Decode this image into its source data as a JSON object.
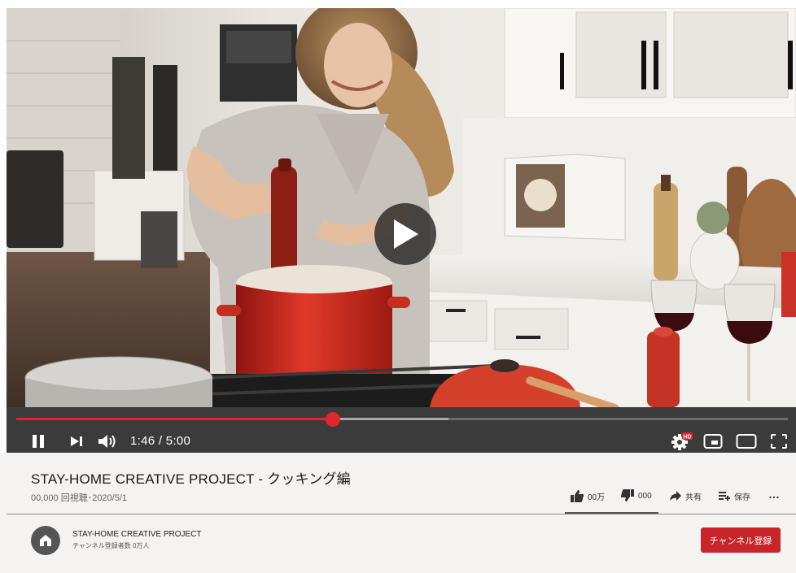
{
  "video": {
    "time_display": "1:46 / 5:00",
    "progress_fraction": 0.41,
    "buffered_fraction": 0.56,
    "hd_badge": "HD"
  },
  "meta": {
    "title": "STAY-HOME CREATIVE PROJECT - クッキング編",
    "views_date": "00,000 回視聴･2020/5/1"
  },
  "actions": {
    "like_count": "00万",
    "dislike_count": "000",
    "share_label": "共有",
    "save_label": "保存",
    "more_label": "…"
  },
  "channel": {
    "name": "STAY-HOME CREATIVE PROJECT",
    "subscribers": "チャンネル登録者数 0万人",
    "subscribe_label": "チャンネル登録"
  },
  "colors": {
    "accent_red": "#e3262c",
    "subscribe_red": "#c8252b",
    "control_bar": "#3b3b3b",
    "info_bg": "#f4f3f1"
  },
  "icons": {
    "play_overlay": "play-icon",
    "pause": "pause-icon",
    "next": "skip-next-icon",
    "volume": "volume-icon",
    "settings": "gear-hd-icon",
    "miniplayer": "miniplayer-icon",
    "theater": "theater-mode-icon",
    "fullscreen": "fullscreen-icon",
    "like": "thumbs-up-icon",
    "dislike": "thumbs-down-icon",
    "share": "share-arrow-icon",
    "save": "playlist-add-icon",
    "avatar": "home-icon"
  }
}
